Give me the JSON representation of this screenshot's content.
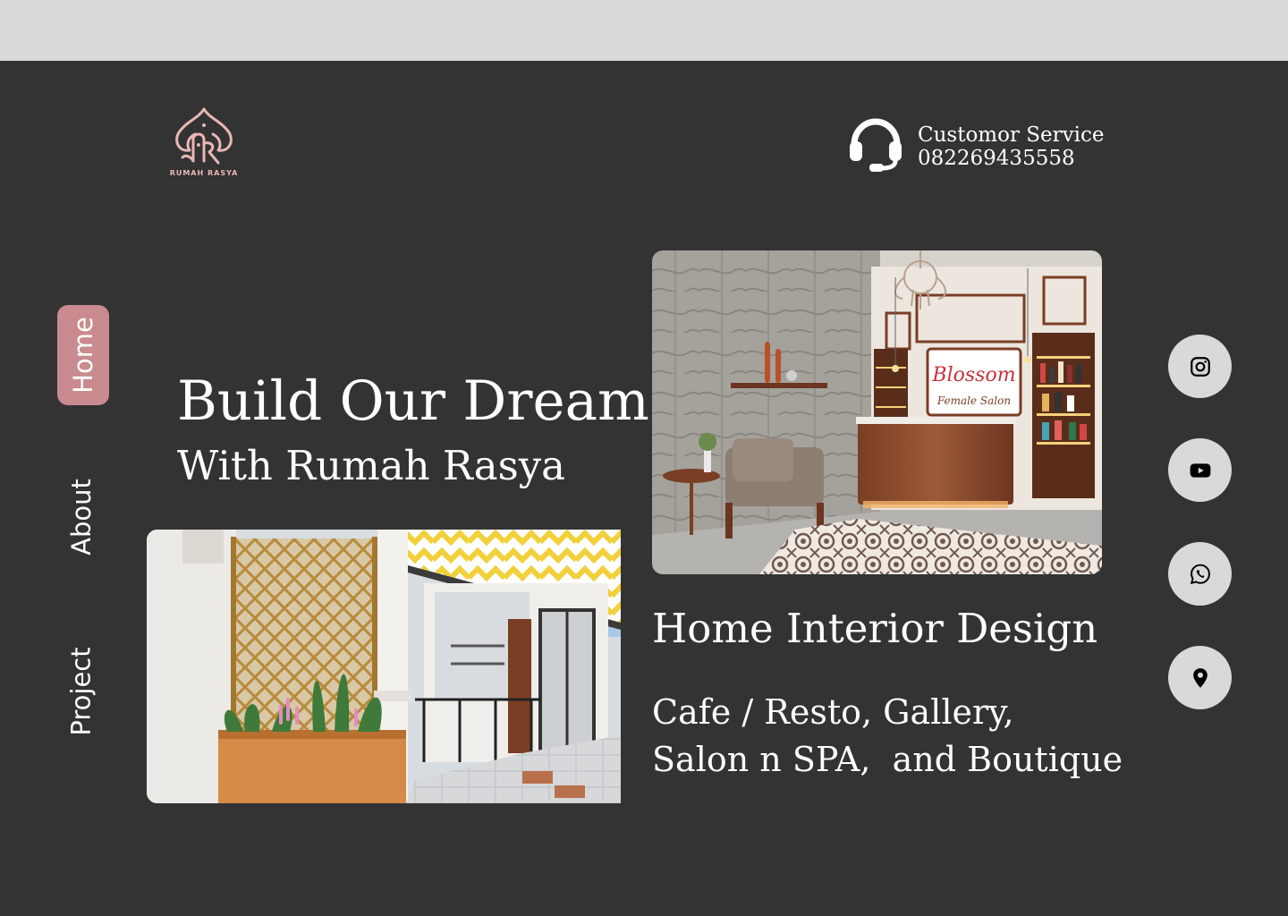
{
  "brand": {
    "name": "RUMAH RASYA",
    "logo_color": "#e9b7b4"
  },
  "customer_service": {
    "label": "Customor Service",
    "phone": "082269435558",
    "icon": "headset-icon"
  },
  "nav": {
    "items": [
      {
        "label": "Home",
        "active": true
      },
      {
        "label": "About",
        "active": false
      },
      {
        "label": "Project",
        "active": false
      }
    ],
    "active_color": "#c98b8f"
  },
  "hero": {
    "title": "Build Our Dream",
    "subtitle": "With Rumah Rasya"
  },
  "images": {
    "salon": {
      "sign_text": "Blossom",
      "sign_subtext": "Female Salon"
    },
    "front": {}
  },
  "services": {
    "title": "Home Interior Design",
    "description": "Cafe / Resto, Gallery,\nSalon n SPA,  and Boutique"
  },
  "social": [
    {
      "name": "instagram-icon"
    },
    {
      "name": "youtube-icon"
    },
    {
      "name": "whatsapp-icon"
    },
    {
      "name": "location-pin-icon"
    }
  ],
  "colors": {
    "background": "#333333",
    "topbar": "#d9d9d9",
    "text": "#ffffff",
    "social_bg": "#d9d9d9"
  }
}
